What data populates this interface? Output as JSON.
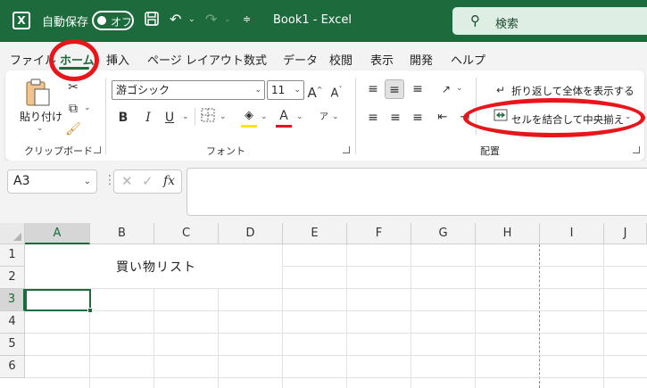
{
  "titlebar": {
    "app_icon": "excel-logo",
    "autosave_label": "自動保存",
    "autosave_state": "オフ",
    "document_title": "Book1 - Excel",
    "search_placeholder": "検索"
  },
  "menu": {
    "tabs": [
      {
        "label": "ファイル"
      },
      {
        "label": "ホーム"
      },
      {
        "label": "挿入"
      },
      {
        "label": "ページ レイアウト"
      },
      {
        "label": "数式"
      },
      {
        "label": "データ"
      },
      {
        "label": "校閲"
      },
      {
        "label": "表示"
      },
      {
        "label": "開発"
      },
      {
        "label": "ヘルプ"
      }
    ],
    "active_tab": "ホーム"
  },
  "ribbon": {
    "clipboard": {
      "paste_label": "貼り付け",
      "group_label": "クリップボード"
    },
    "font": {
      "font_name": "游ゴシック",
      "font_size": "11",
      "bold": "B",
      "italic": "I",
      "underline": "U",
      "font_color_glyph": "A",
      "furigana_glyph": "ア",
      "group_label": "フォント",
      "fill_color": "#ffe600",
      "font_color": "#e81123"
    },
    "alignment": {
      "wrap_text_label": "折り返して全体を表示する",
      "merge_center_label": "セルを結合して中央揃え",
      "group_label": "配置"
    }
  },
  "formula_bar": {
    "name_box": "A3",
    "fx_label": "fx",
    "formula": ""
  },
  "grid": {
    "columns": [
      "A",
      "B",
      "C",
      "D",
      "E",
      "F",
      "G",
      "H",
      "I",
      "J"
    ],
    "rows": [
      "1",
      "2",
      "3",
      "4",
      "5",
      "6"
    ],
    "selected_column": "A",
    "selected_row": "3",
    "merged_cell_text": "買い物リスト"
  },
  "colors": {
    "accent": "#1d6b3d",
    "annotation": "#e8161b"
  }
}
